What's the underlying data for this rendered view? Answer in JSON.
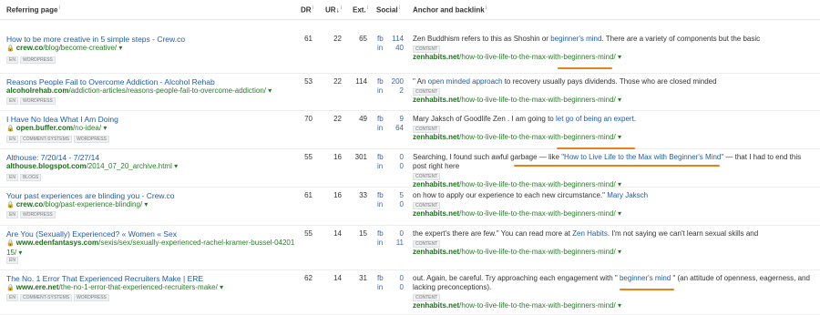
{
  "headers": {
    "referring_page": "Referring page",
    "dr": "DR",
    "ur": "UR",
    "ext": "Ext.",
    "social": "Social",
    "anchor": "Anchor and backlink",
    "info_glyph": "i",
    "sort_glyph": "↓"
  },
  "social_labels": {
    "fb": "fb",
    "in": "in"
  },
  "content_tag": "CONTENT",
  "accent_underline": "#e8801e",
  "rows": [
    {
      "title": "How to be more creative in 5 simple steps - Crew.co",
      "domain": "crew.co",
      "path": "/blog/become-creative/",
      "secure": true,
      "tags": [
        "EN",
        "WORDPRESS"
      ],
      "dr": "61",
      "ur": "22",
      "ext": "65",
      "fb": "114",
      "in": "40",
      "anchor_before": "Zen Buddhism refers to this as Shoshin or ",
      "anchor_link": "beginner's mind",
      "anchor_after": ". There are a variety of components but the basic",
      "backlink_domain": "zenhabits.net",
      "backlink_path": "/how-to-live-life-to-the-max-with-beginners-mind/"
    },
    {
      "title": "Reasons People Fail to Overcome Addiction - Alcohol Rehab",
      "domain": "alcoholrehab.com",
      "path": "/addiction-articles/reasons-people-fail-to-overcome-addiction/",
      "secure": false,
      "tags": [
        "EN",
        "WORDPRESS"
      ],
      "dr": "53",
      "ur": "22",
      "ext": "114",
      "fb": "200",
      "in": "2",
      "anchor_before": "\" An ",
      "anchor_link": "open minded approach",
      "anchor_after": " to recovery usually pays dividends. Those who are closed minded",
      "backlink_domain": "zenhabits.net",
      "backlink_path": "/how-to-live-life-to-the-max-with-beginners-mind/"
    },
    {
      "title": "I Have No Idea What I Am Doing",
      "domain": "open.buffer.com",
      "path": "/no-idea/",
      "secure": true,
      "tags": [
        "EN",
        "COMMENT-SYSTEMS",
        "WORDPRESS"
      ],
      "dr": "70",
      "ur": "22",
      "ext": "49",
      "fb": "9",
      "in": "64",
      "anchor_before": "Mary Jaksch of Goodlife Zen . I am going to ",
      "anchor_link": "let go of being an expert",
      "anchor_after": ".",
      "backlink_domain": "zenhabits.net",
      "backlink_path": "/how-to-live-life-to-the-max-with-beginners-mind/"
    },
    {
      "title": "Althouse: 7/20/14 - 7/27/14",
      "domain": "althouse.blogspot.com",
      "path": "/2014_07_20_archive.html",
      "secure": false,
      "tags": [
        "EN",
        "BLOGS"
      ],
      "dr": "55",
      "ur": "16",
      "ext": "301",
      "fb": "0",
      "in": "0",
      "anchor_before": "Searching, I found such awful garbage — like ",
      "anchor_link": "\"How to Live Life to the Max with Beginner's Mind\"",
      "anchor_after": " — that I had to end this post right here",
      "backlink_domain": "zenhabits.net",
      "backlink_path": "/how-to-live-life-to-the-max-with-beginners-mind/"
    },
    {
      "title": "Your past experiences are blinding you - Crew.co",
      "domain": "crew.co",
      "path": "/blog/past-experience-blinding/",
      "secure": true,
      "tags": [
        "EN",
        "WORDPRESS"
      ],
      "dr": "61",
      "ur": "16",
      "ext": "33",
      "fb": "5",
      "in": "0",
      "anchor_before": "on how to apply our experience to each new circumstance.\" ",
      "anchor_link": "Mary Jaksch",
      "anchor_after": "",
      "backlink_domain": "zenhabits.net",
      "backlink_path": "/how-to-live-life-to-the-max-with-beginners-mind/"
    },
    {
      "title": "Are You (Sexually) Experienced? « Women « Sex",
      "domain": "www.edenfantasys.com",
      "path": "/sexis/sex/sexually-experienced-rachel-kramer-bussel-04201",
      "path2": "15/",
      "secure": true,
      "tags": [
        "EN"
      ],
      "dr": "55",
      "ur": "14",
      "ext": "15",
      "fb": "0",
      "in": "11",
      "anchor_before": "the expert's there are few.\" You can read more at ",
      "anchor_link": "Zen Habits",
      "anchor_after": ". I'm not saying we can't learn sexual skills and",
      "backlink_domain": "zenhabits.net",
      "backlink_path": "/how-to-live-life-to-the-max-with-beginners-mind/"
    },
    {
      "title": "The No. 1 Error That Experienced Recruiters Make | ERE",
      "domain": "www.ere.net",
      "path": "/the-no-1-error-that-experienced-recruiters-make/",
      "secure": true,
      "tags": [
        "EN",
        "COMMENT-SYSTEMS",
        "WORDPRESS"
      ],
      "dr": "62",
      "ur": "14",
      "ext": "31",
      "fb": "0",
      "in": "0",
      "anchor_before": "out. Again, be careful. Try approaching each engagement with \" ",
      "anchor_link": "beginner's mind",
      "anchor_after": " \" (an attitude of openness, eagerness, and lacking preconceptions).",
      "backlink_domain": "zenhabits.net",
      "backlink_path": "/how-to-live-life-to-the-max-with-beginners-mind/"
    }
  ]
}
